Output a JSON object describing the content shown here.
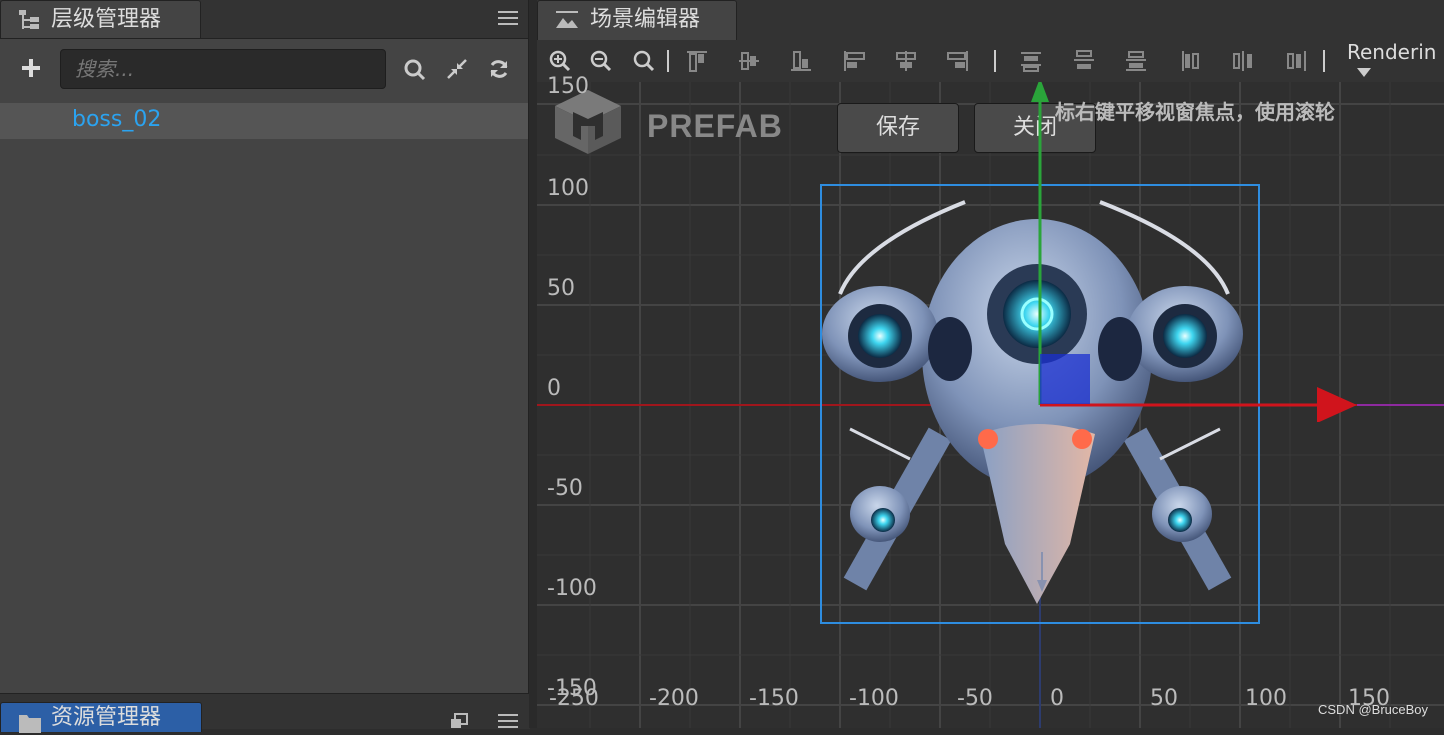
{
  "hierarchy": {
    "tab_title": "层级管理器",
    "search_placeholder": "搜索...",
    "tree": [
      {
        "label": "boss_02"
      }
    ]
  },
  "assets": {
    "tab_title": "资源管理器"
  },
  "scene": {
    "tab_title": "场景编辑器",
    "rendering_label": "Renderin",
    "prefab_label": "PREFAB",
    "save_label": "保存",
    "close_label": "关闭",
    "hint_text": "标右键平移视窗焦点，使用滚轮",
    "y_labels": [
      "150",
      "100",
      "50",
      "0",
      "-50",
      "-100",
      "-150"
    ],
    "x_labels": [
      "-250",
      "-200",
      "-150",
      "-100",
      "-50",
      "0",
      "50",
      "100",
      "150"
    ],
    "selected_node": "boss_02"
  },
  "watermark": "CSDN @BruceBoy",
  "colors": {
    "accent_blue": "#2ba3f0",
    "axis_x": "#d0141c",
    "axis_y": "#2aa43a",
    "selection": "#2e8de0"
  }
}
